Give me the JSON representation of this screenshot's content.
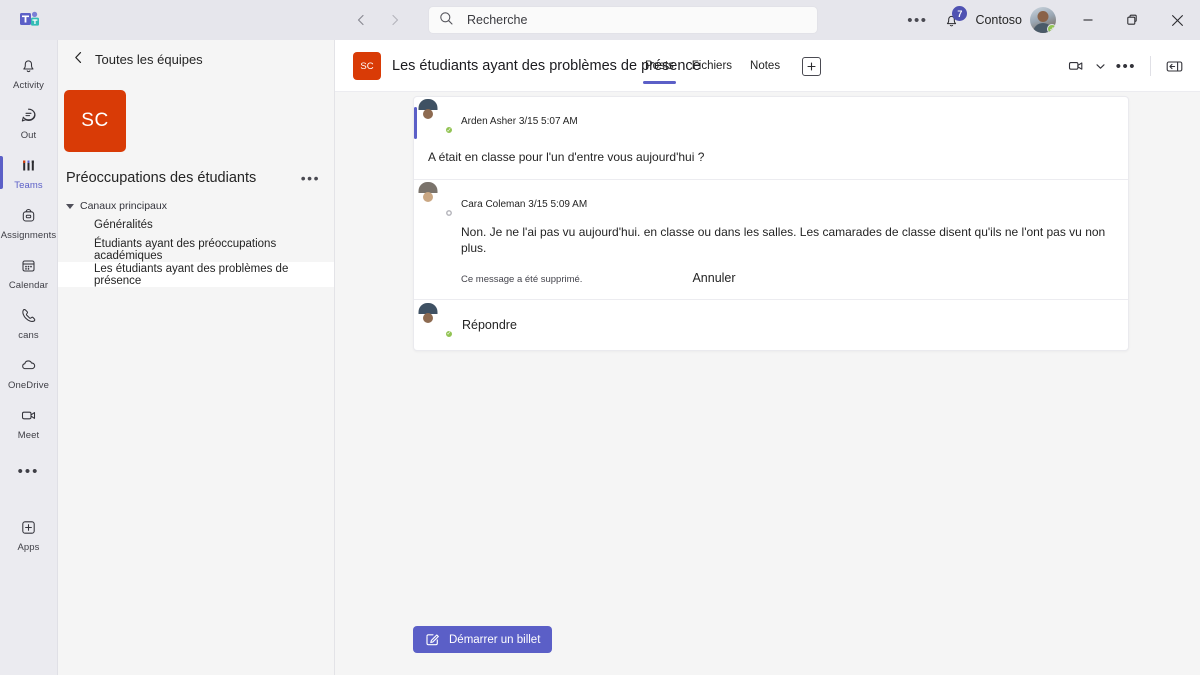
{
  "titlebar": {
    "logo_icon": "teams-logo-icon",
    "back_icon": "chevron-left-icon",
    "forward_icon": "chevron-right-icon",
    "search": {
      "placeholder": "Recherche",
      "value": "",
      "icon": "search-icon"
    },
    "more_icon": "ellipsis-icon",
    "notifications": {
      "icon": "bell-icon",
      "badge": "7"
    },
    "org_name": "Contoso",
    "avatar": {
      "name": "user-avatar",
      "presence": "available"
    },
    "window": {
      "minimize": "minimize-icon",
      "restore": "restore-icon",
      "close": "close-icon"
    }
  },
  "rail": {
    "items": [
      {
        "label": "Activity",
        "icon": "bell-icon",
        "active": false
      },
      {
        "label": "Out",
        "icon": "chat-icon",
        "active": false
      },
      {
        "label": "Teams",
        "icon": "teams-icon",
        "active": true
      },
      {
        "label": "Assignments",
        "icon": "backpack-icon",
        "active": false
      },
      {
        "label": "Calendar",
        "icon": "calendar-icon",
        "active": false
      },
      {
        "label": "cans",
        "icon": "phone-icon",
        "active": false
      },
      {
        "label": "OneDrive",
        "icon": "cloud-icon",
        "active": false
      },
      {
        "label": "Meet",
        "icon": "video-camera-icon",
        "active": false
      },
      {
        "label": "",
        "icon": "ellipsis-icon",
        "active": false
      },
      {
        "label": "Apps",
        "icon": "plus-box-icon",
        "active": false
      }
    ]
  },
  "panel": {
    "back_label": "Toutes les équipes",
    "back_icon": "chevron-left-icon",
    "team_avatar_initials": "SC",
    "team_name": "Préoccupations des étudiants",
    "team_more_icon": "ellipsis-icon",
    "group_label": "Canaux principaux",
    "group_chevron_icon": "chevron-down-icon",
    "channels": [
      {
        "label": "Généralités",
        "selected": false
      },
      {
        "label": "Étudiants ayant des préoccupations académiques",
        "selected": false
      },
      {
        "label": "Les étudiants ayant des problèmes de présence",
        "selected": true
      }
    ]
  },
  "channel_header": {
    "avatar_initials": "SC",
    "title": "Les étudiants ayant des problèmes de présence",
    "tabs": [
      {
        "label": "Posts",
        "active": true
      },
      {
        "label": "Fichiers",
        "active": false
      },
      {
        "label": "Notes",
        "active": false
      }
    ],
    "add_tab_icon": "plus-icon",
    "actions": {
      "meet_icon": "video-camera-icon",
      "meet_chevron_icon": "chevron-down-icon",
      "more_icon": "ellipsis-icon",
      "panel_icon": "open-panel-icon"
    }
  },
  "thread": {
    "posts": [
      {
        "author": "Arden Asher",
        "timestamp": "3/15 5:07 AM",
        "meta": "Arden Asher 3/15 5:07 AM",
        "body": "A était en classe pour l'un d'entre vous aujourd'hui ?",
        "presence": "available"
      },
      {
        "author": "Cara Coleman",
        "timestamp": "3/15 5:09 AM",
        "meta": "Cara Coleman 3/15 5:09 AM",
        "body": "Non. Je ne l'ai pas vu aujourd'hui. en classe ou dans les salles. Les camarades de classe disent qu'ils ne l'ont pas vu non plus.",
        "presence": "away"
      }
    ],
    "deleted_notice": "Ce message a été supprimé.",
    "undo_label": "Annuler",
    "reply_label": "Répondre"
  },
  "ticket_button": {
    "label": "Démarrer un billet",
    "icon": "compose-icon"
  },
  "colors": {
    "accent_purple": "#5b5fc7",
    "team_orange": "#d93b06",
    "titlebar_bg": "#e6e6ec",
    "rail_bg": "#ebebf0",
    "panel_bg": "#f5f5f5",
    "presence_green": "#92c353"
  }
}
